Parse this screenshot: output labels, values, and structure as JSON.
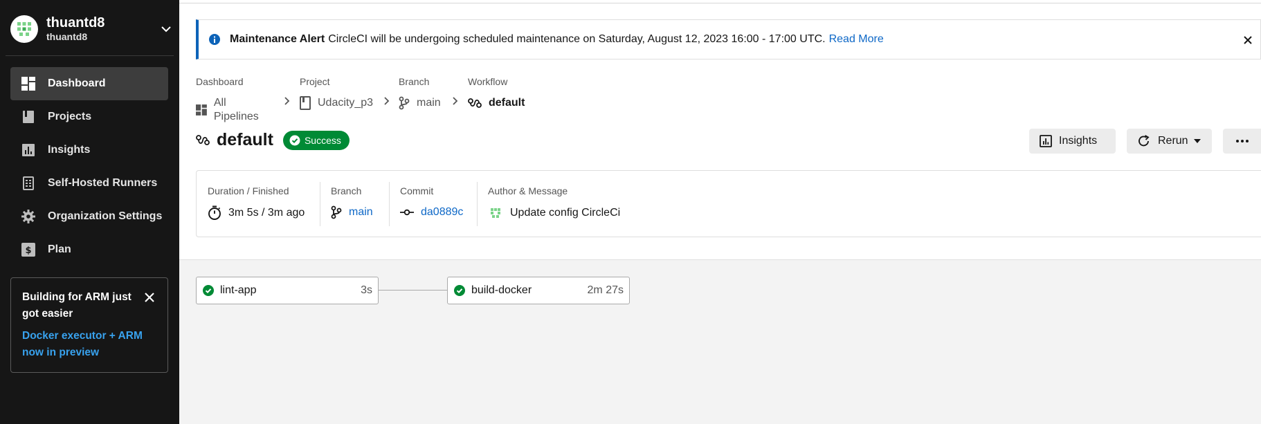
{
  "org": {
    "name": "thuantd8",
    "sub": "thuantd8"
  },
  "sidebar": {
    "items": [
      {
        "label": "Dashboard",
        "icon": "dashboard-icon",
        "active": true
      },
      {
        "label": "Projects",
        "icon": "projects-icon"
      },
      {
        "label": "Insights",
        "icon": "insights-icon"
      },
      {
        "label": "Self-Hosted Runners",
        "icon": "runners-icon"
      },
      {
        "label": "Organization Settings",
        "icon": "gear-icon"
      },
      {
        "label": "Plan",
        "icon": "dollar-icon"
      }
    ],
    "promo": {
      "title": "Building for ARM just got easier",
      "link": "Docker executor + ARM now in preview"
    }
  },
  "alert": {
    "title": "Maintenance Alert",
    "text": "CircleCI will be undergoing scheduled maintenance on Saturday, August 12, 2023 16:00 - 17:00 UTC.",
    "link": "Read More"
  },
  "breadcrumb": {
    "dashboard": {
      "label": "Dashboard",
      "value": "All Pipelines"
    },
    "project": {
      "label": "Project",
      "value": "Udacity_p3"
    },
    "branch": {
      "label": "Branch",
      "value": "main"
    },
    "workflow": {
      "label": "Workflow",
      "value": "default"
    }
  },
  "header": {
    "title": "default",
    "status": "Success",
    "insights_label": "Insights",
    "rerun_label": "Rerun"
  },
  "meta": {
    "duration": {
      "label": "Duration / Finished",
      "value": "3m 5s / 3m ago"
    },
    "branch": {
      "label": "Branch",
      "value": "main"
    },
    "commit": {
      "label": "Commit",
      "value": "da0889c"
    },
    "author": {
      "label": "Author & Message",
      "value": "Update config CircleCi"
    }
  },
  "jobs": [
    {
      "name": "lint-app",
      "duration": "3s",
      "status": "success"
    },
    {
      "name": "build-docker",
      "duration": "2m 27s",
      "status": "success"
    }
  ],
  "colors": {
    "success": "#008a35",
    "link": "#0e68c7",
    "sidebar_bg": "#161616",
    "alert_accent": "#0d63b8"
  }
}
